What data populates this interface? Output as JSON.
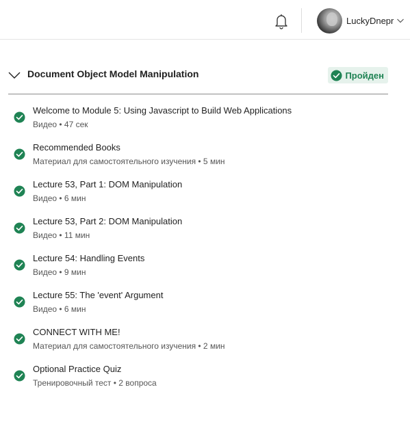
{
  "header": {
    "username": "LuckyDnepr"
  },
  "module": {
    "title": "Document Object Model Manipulation",
    "status": "Пройден"
  },
  "items": [
    {
      "title": "Welcome to Module 5: Using Javascript to Build Web Applications",
      "meta": "Видео • 47 сек"
    },
    {
      "title": "Recommended Books",
      "meta": "Материал для самостоятельного изучения • 5 мин"
    },
    {
      "title": "Lecture 53, Part 1: DOM Manipulation",
      "meta": "Видео • 6 мин"
    },
    {
      "title": "Lecture 53, Part 2: DOM Manipulation",
      "meta": "Видео • 11 мин"
    },
    {
      "title": "Lecture 54: Handling Events",
      "meta": "Видео • 9 мин"
    },
    {
      "title": "Lecture 55: The 'event' Argument",
      "meta": "Видео • 6 мин"
    },
    {
      "title": "CONNECT WITH ME!",
      "meta": "Материал для самостоятельного изучения • 2 мин"
    },
    {
      "title": "Optional Practice Quiz",
      "meta": "Тренировочный тест • 2 вопроса"
    }
  ],
  "icons": {
    "notifications": "bell-icon",
    "user_menu": "chevron-down-icon",
    "collapse": "chevron-down-icon",
    "completed": "check-circle-icon"
  },
  "colors": {
    "success": "#1f8354",
    "success_bg": "#e6f2ec"
  }
}
